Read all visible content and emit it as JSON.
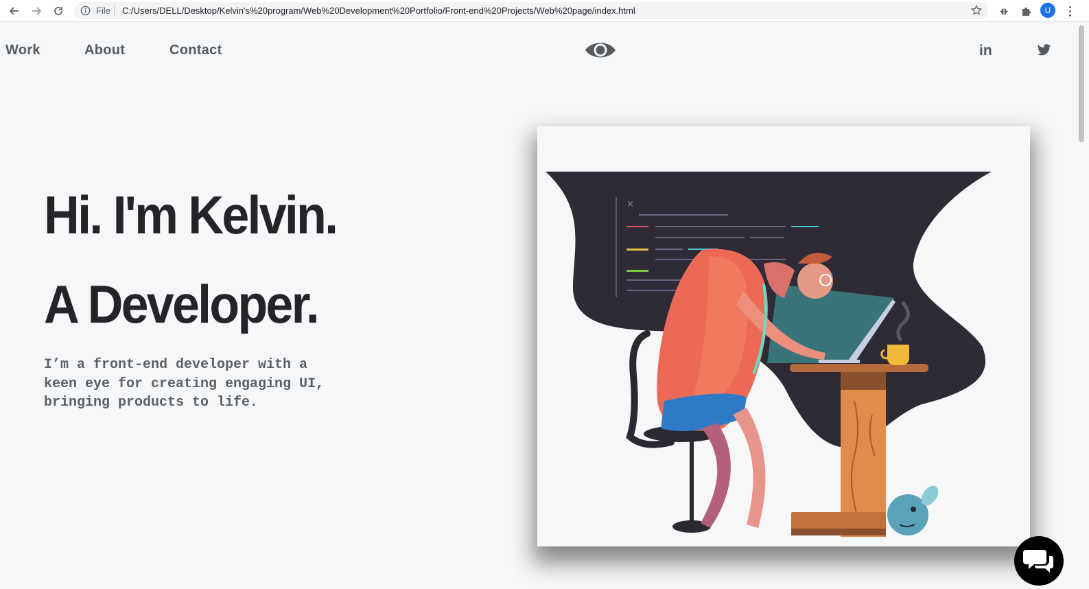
{
  "browser": {
    "scheme_label": "File",
    "url": "C:/Users/DELL/Desktop/Kelvin's%20program/Web%20Development%20Portfolio/Front-end%20Projects/Web%20page/index.html",
    "avatar_letter": "U"
  },
  "nav": {
    "items": [
      {
        "label": "Work"
      },
      {
        "label": "About"
      },
      {
        "label": "Contact"
      }
    ],
    "logo_icon": "eye-icon",
    "social": [
      {
        "label": "in",
        "icon": "linkedin-icon"
      },
      {
        "icon": "twitter-icon"
      }
    ]
  },
  "hero": {
    "line1": "Hi. I'm Kelvin.",
    "line2": "A Developer.",
    "description": "I’m a front-end developer with a keen eye for creating engaging UI, bringing products to life."
  },
  "illustration": {
    "icon": "developer-at-desk-illustration"
  },
  "chat_widget": {
    "icon": "chat-bubbles-icon"
  },
  "colors": {
    "page_bg": "#f6f7f9",
    "heading": "#23242a",
    "nav_text": "#555a60",
    "blob": "#2e2a36",
    "chat_bg": "#000000"
  }
}
